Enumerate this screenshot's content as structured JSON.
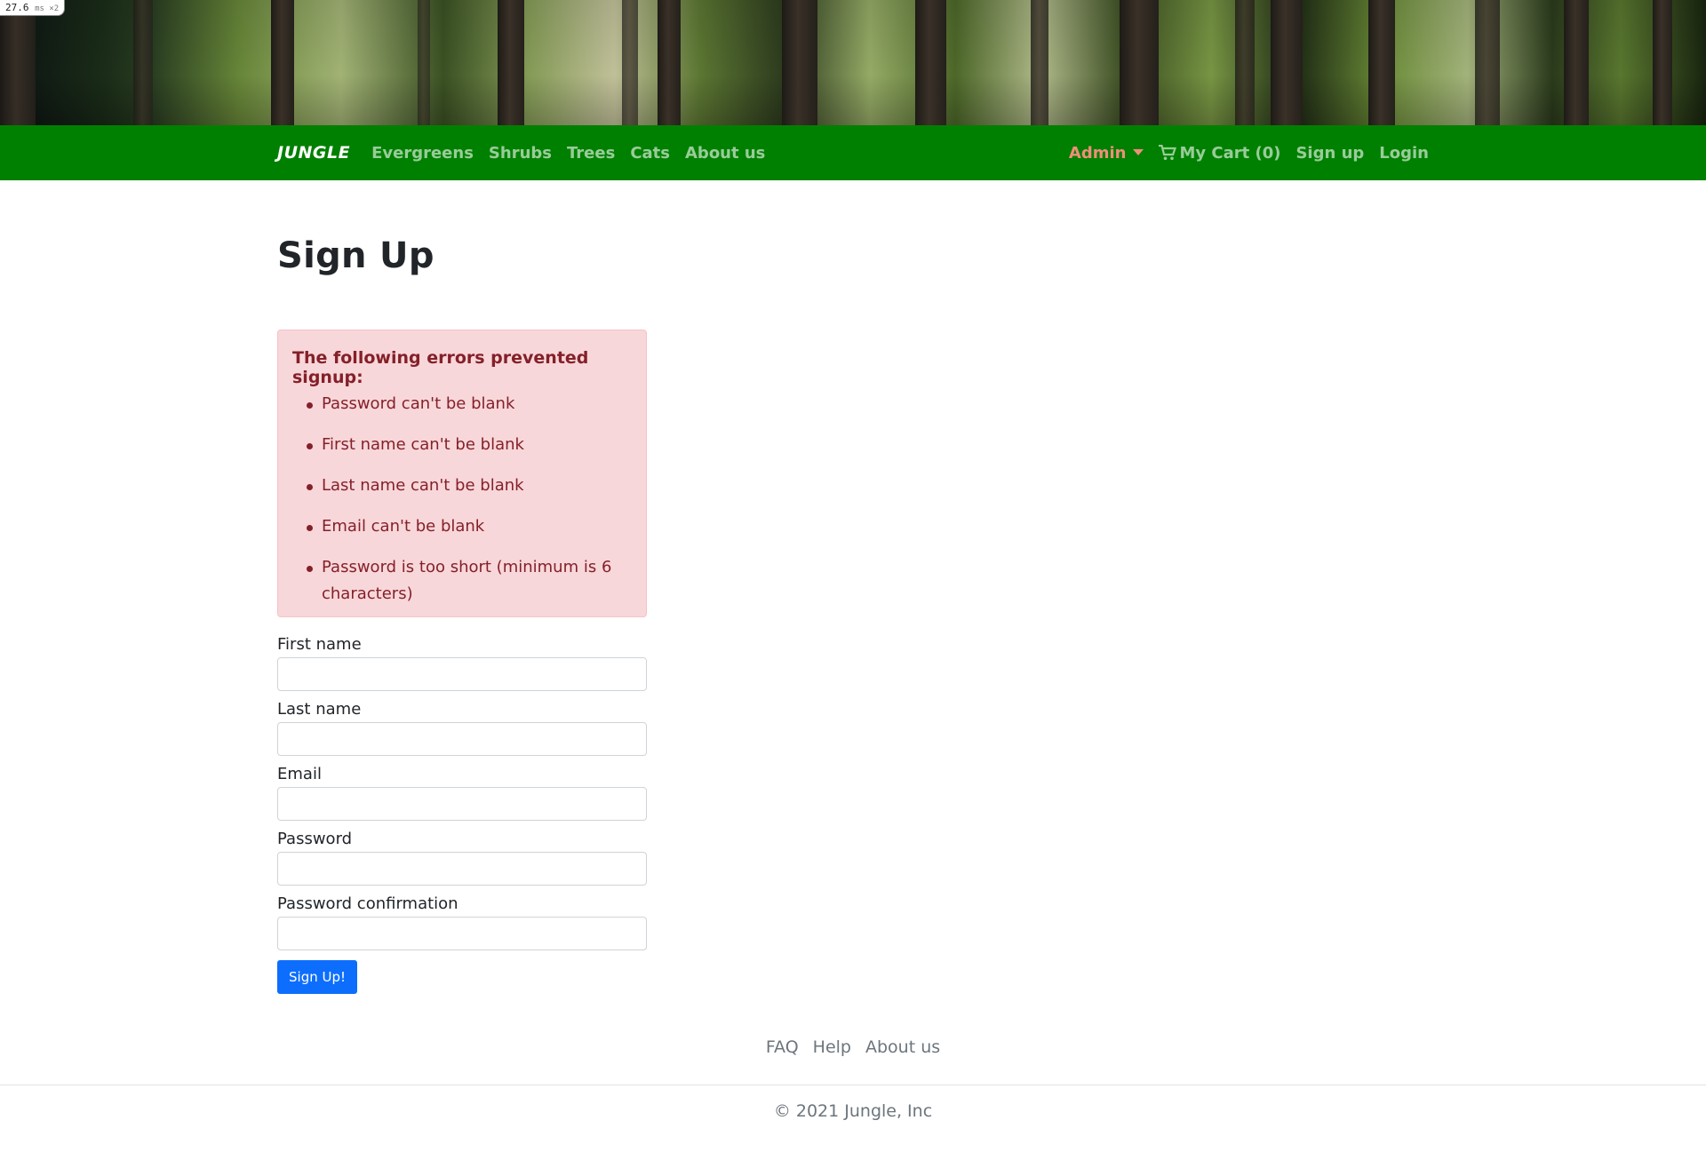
{
  "perf": {
    "value": "27.6",
    "unit": "ms ×2"
  },
  "navbar": {
    "brand": "JUNGLE",
    "links": [
      "Evergreens",
      "Shrubs",
      "Trees",
      "Cats",
      "About us"
    ],
    "admin": "Admin",
    "cart": "My Cart (0)",
    "signup": "Sign up",
    "login": "Login"
  },
  "page": {
    "title": "Sign Up"
  },
  "errors": {
    "heading": "The following errors prevented signup:",
    "items": [
      "Password can't be blank",
      "First name can't be blank",
      "Last name can't be blank",
      "Email can't be blank",
      "Password is too short (minimum is 6 characters)"
    ]
  },
  "form": {
    "first_name_label": "First name",
    "last_name_label": "Last name",
    "email_label": "Email",
    "password_label": "Password",
    "password_confirmation_label": "Password confirmation",
    "submit_label": "Sign Up!"
  },
  "footer": {
    "links": [
      "FAQ",
      "Help",
      "About us"
    ],
    "copyright": "© 2021 Jungle, Inc"
  },
  "colors": {
    "navbar": "#008000",
    "admin": "#f08e7a",
    "alert_bg": "#f8d7da",
    "alert_text": "#842029",
    "primary": "#0d6efd"
  }
}
